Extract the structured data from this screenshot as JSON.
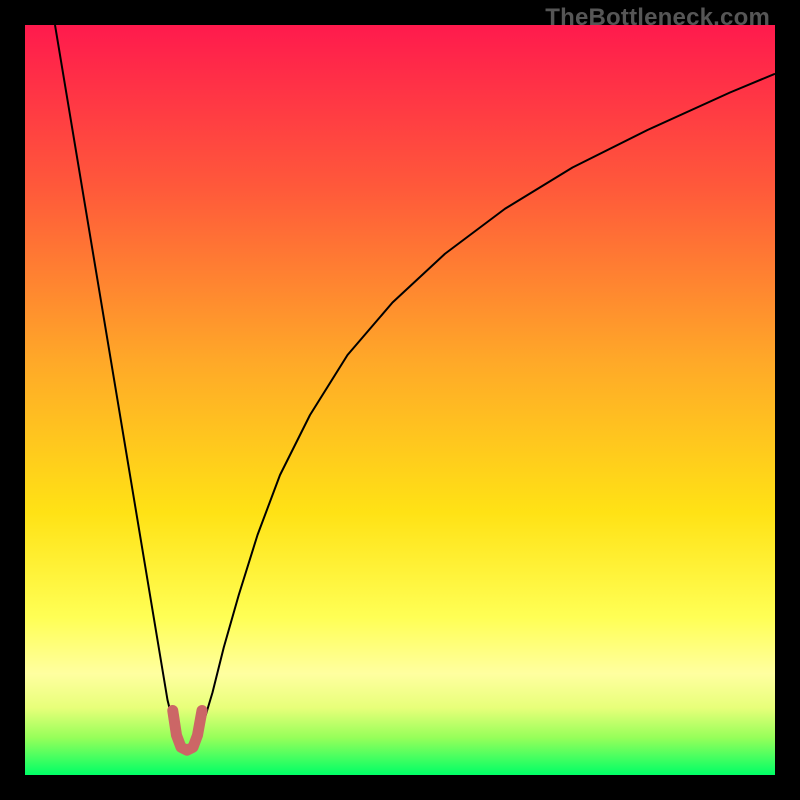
{
  "watermark": "TheBottleneck.com",
  "chart_data": {
    "type": "line",
    "title": "",
    "xlabel": "",
    "ylabel": "",
    "xlim": [
      0,
      100
    ],
    "ylim": [
      0,
      100
    ],
    "grid": false,
    "legend": false,
    "background_gradient": {
      "stops": [
        {
          "pos": 0.0,
          "color": "#ff1a4d"
        },
        {
          "pos": 0.22,
          "color": "#ff5a3a"
        },
        {
          "pos": 0.45,
          "color": "#ffa928"
        },
        {
          "pos": 0.65,
          "color": "#ffe215"
        },
        {
          "pos": 0.79,
          "color": "#ffff55"
        },
        {
          "pos": 0.865,
          "color": "#ffffa0"
        },
        {
          "pos": 0.91,
          "color": "#e8ff7a"
        },
        {
          "pos": 0.95,
          "color": "#97ff5a"
        },
        {
          "pos": 1.0,
          "color": "#00ff66"
        }
      ]
    },
    "series": [
      {
        "name": "curve",
        "color": "#000000",
        "stroke_width": 2,
        "x": [
          4,
          6,
          8,
          10,
          12,
          14,
          16,
          18,
          19,
          20,
          20.8,
          21.5,
          22.3,
          23.5,
          25,
          26.5,
          28.5,
          31,
          34,
          38,
          43,
          49,
          56,
          64,
          73,
          83,
          94,
          100
        ],
        "y": [
          100,
          88,
          76,
          64,
          52,
          40,
          28,
          16,
          10,
          6,
          3.5,
          3,
          3.5,
          6,
          11,
          17,
          24,
          32,
          40,
          48,
          56,
          63,
          69.5,
          75.5,
          81,
          86,
          91,
          93.5
        ]
      },
      {
        "name": "marker-u",
        "color": "#cc6666",
        "stroke_width": 11,
        "linecap": "round",
        "x": [
          19.7,
          20.2,
          20.8,
          21.6,
          22.4,
          23.0,
          23.6
        ],
        "y": [
          8.6,
          5.3,
          3.7,
          3.3,
          3.7,
          5.3,
          8.6
        ]
      }
    ]
  }
}
